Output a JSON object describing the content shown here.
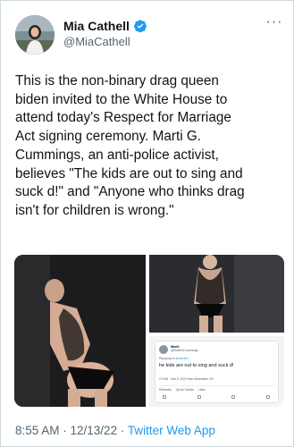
{
  "author": {
    "display_name": "Mia Cathell",
    "handle": "@MiaCathell",
    "verified": true
  },
  "more_icon": "more-horizontal-icon",
  "tweet": {
    "text": "This is the non-binary drag queen\nbiden invited to the White House to\nattend today's Respect for Marriage\nAct signing ceremony. Marti G.\nCummings, an anti-police activist,\nbelieves \"The kids are out to sing and\nsuck d!\" and \"Anyone who thinks drag\nisn't for children is wrong.\""
  },
  "quoted_tweet": {
    "name": "Marti",
    "handle": "@MartiGCummings",
    "reply_prefix": "Replying to",
    "reply_to": "@davidG",
    "text": "he kids are out to sing and suck d!",
    "time": "2:0 AM · Mar 8, 2020 from Manhattan, NY",
    "stats": [
      "Retweets",
      "Quote Tweets",
      "Likes"
    ]
  },
  "meta": {
    "time": "8:55 AM · 12/13/22 · ",
    "source": "Twitter Web App"
  },
  "colors": {
    "link": "#1d9bf0",
    "secondary_text": "#536471",
    "border": "#cfd9de"
  }
}
